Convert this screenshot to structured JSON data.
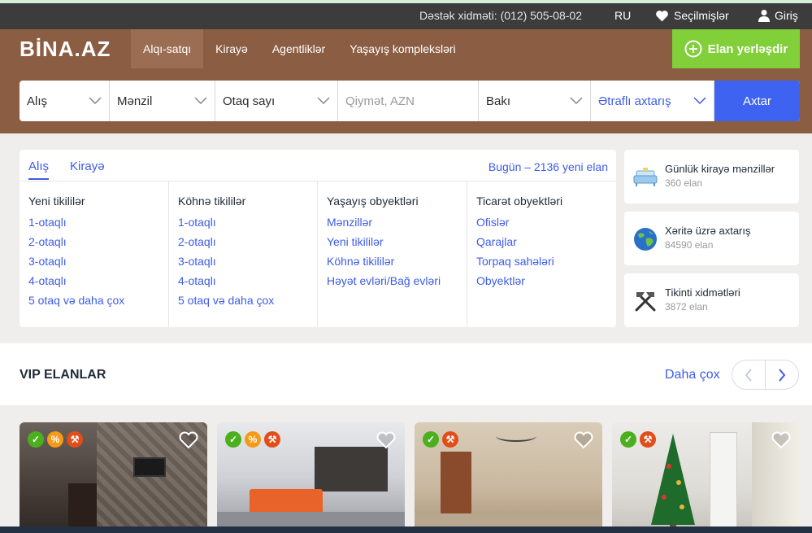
{
  "topbar": {
    "support": "Dəstək xidməti: (012) 505-08-02",
    "lang": "RU",
    "favorites": "Seçilmişlər",
    "login": "Giriş"
  },
  "header": {
    "logo": "BİNA.AZ",
    "nav": [
      "Alqı-satqı",
      "Kirayə",
      "Agentliklər",
      "Yaşayış kompleksləri"
    ],
    "post_button": "Elan yerləşdir"
  },
  "search": {
    "deal": "Alış",
    "type": "Mənzil",
    "rooms": "Otaq sayı",
    "price_placeholder": "Qiymət, AZN",
    "city": "Bakı",
    "advanced": "Ətraflı axtarış",
    "button": "Axtar"
  },
  "categories": {
    "tabs": [
      "Alış",
      "Kirayə"
    ],
    "today": "Bugün – 2136 yeni elan",
    "columns": [
      {
        "title": "Yeni tikililər",
        "links": [
          "1-otaqlı",
          "2-otaqlı",
          "3-otaqlı",
          "4-otaqlı",
          "5 otaq və daha çox"
        ]
      },
      {
        "title": "Köhnə tikililər",
        "links": [
          "1-otaqlı",
          "2-otaqlı",
          "3-otaqlı",
          "4-otaqlı",
          "5 otaq və daha çox"
        ]
      },
      {
        "title": "Yaşayış obyektləri",
        "links": [
          "Mənzillər",
          "Yeni tikililər",
          "Köhnə tikililər",
          "Həyət evləri/Bağ evləri"
        ]
      },
      {
        "title": "Ticarət obyektləri",
        "links": [
          "Ofislər",
          "Qarajlar",
          "Torpaq sahələri",
          "Obyektlər"
        ]
      }
    ]
  },
  "side_cards": [
    {
      "title": "Günlük kirayə mənzillər",
      "count": "360 elan",
      "icon": "sofa-icon"
    },
    {
      "title": "Xəritə üzrə axtarış",
      "count": "84590 elan",
      "icon": "globe-icon"
    },
    {
      "title": "Tikinti xidmətləri",
      "count": "3872 elan",
      "icon": "tools-icon"
    }
  ],
  "vip": {
    "title": "VIP ELANLAR",
    "more": "Daha çox"
  },
  "listings": [
    {
      "badges": [
        "deed",
        "percent",
        "hammer"
      ]
    },
    {
      "badges": [
        "deed",
        "percent",
        "hammer"
      ]
    },
    {
      "badges": [
        "deed",
        "hammer"
      ]
    },
    {
      "badges": [
        "deed",
        "hammer"
      ]
    }
  ],
  "colors": {
    "brand_brown": "#8b5e44",
    "accent_blue": "#3d63f0",
    "post_green": "#81cf39"
  }
}
